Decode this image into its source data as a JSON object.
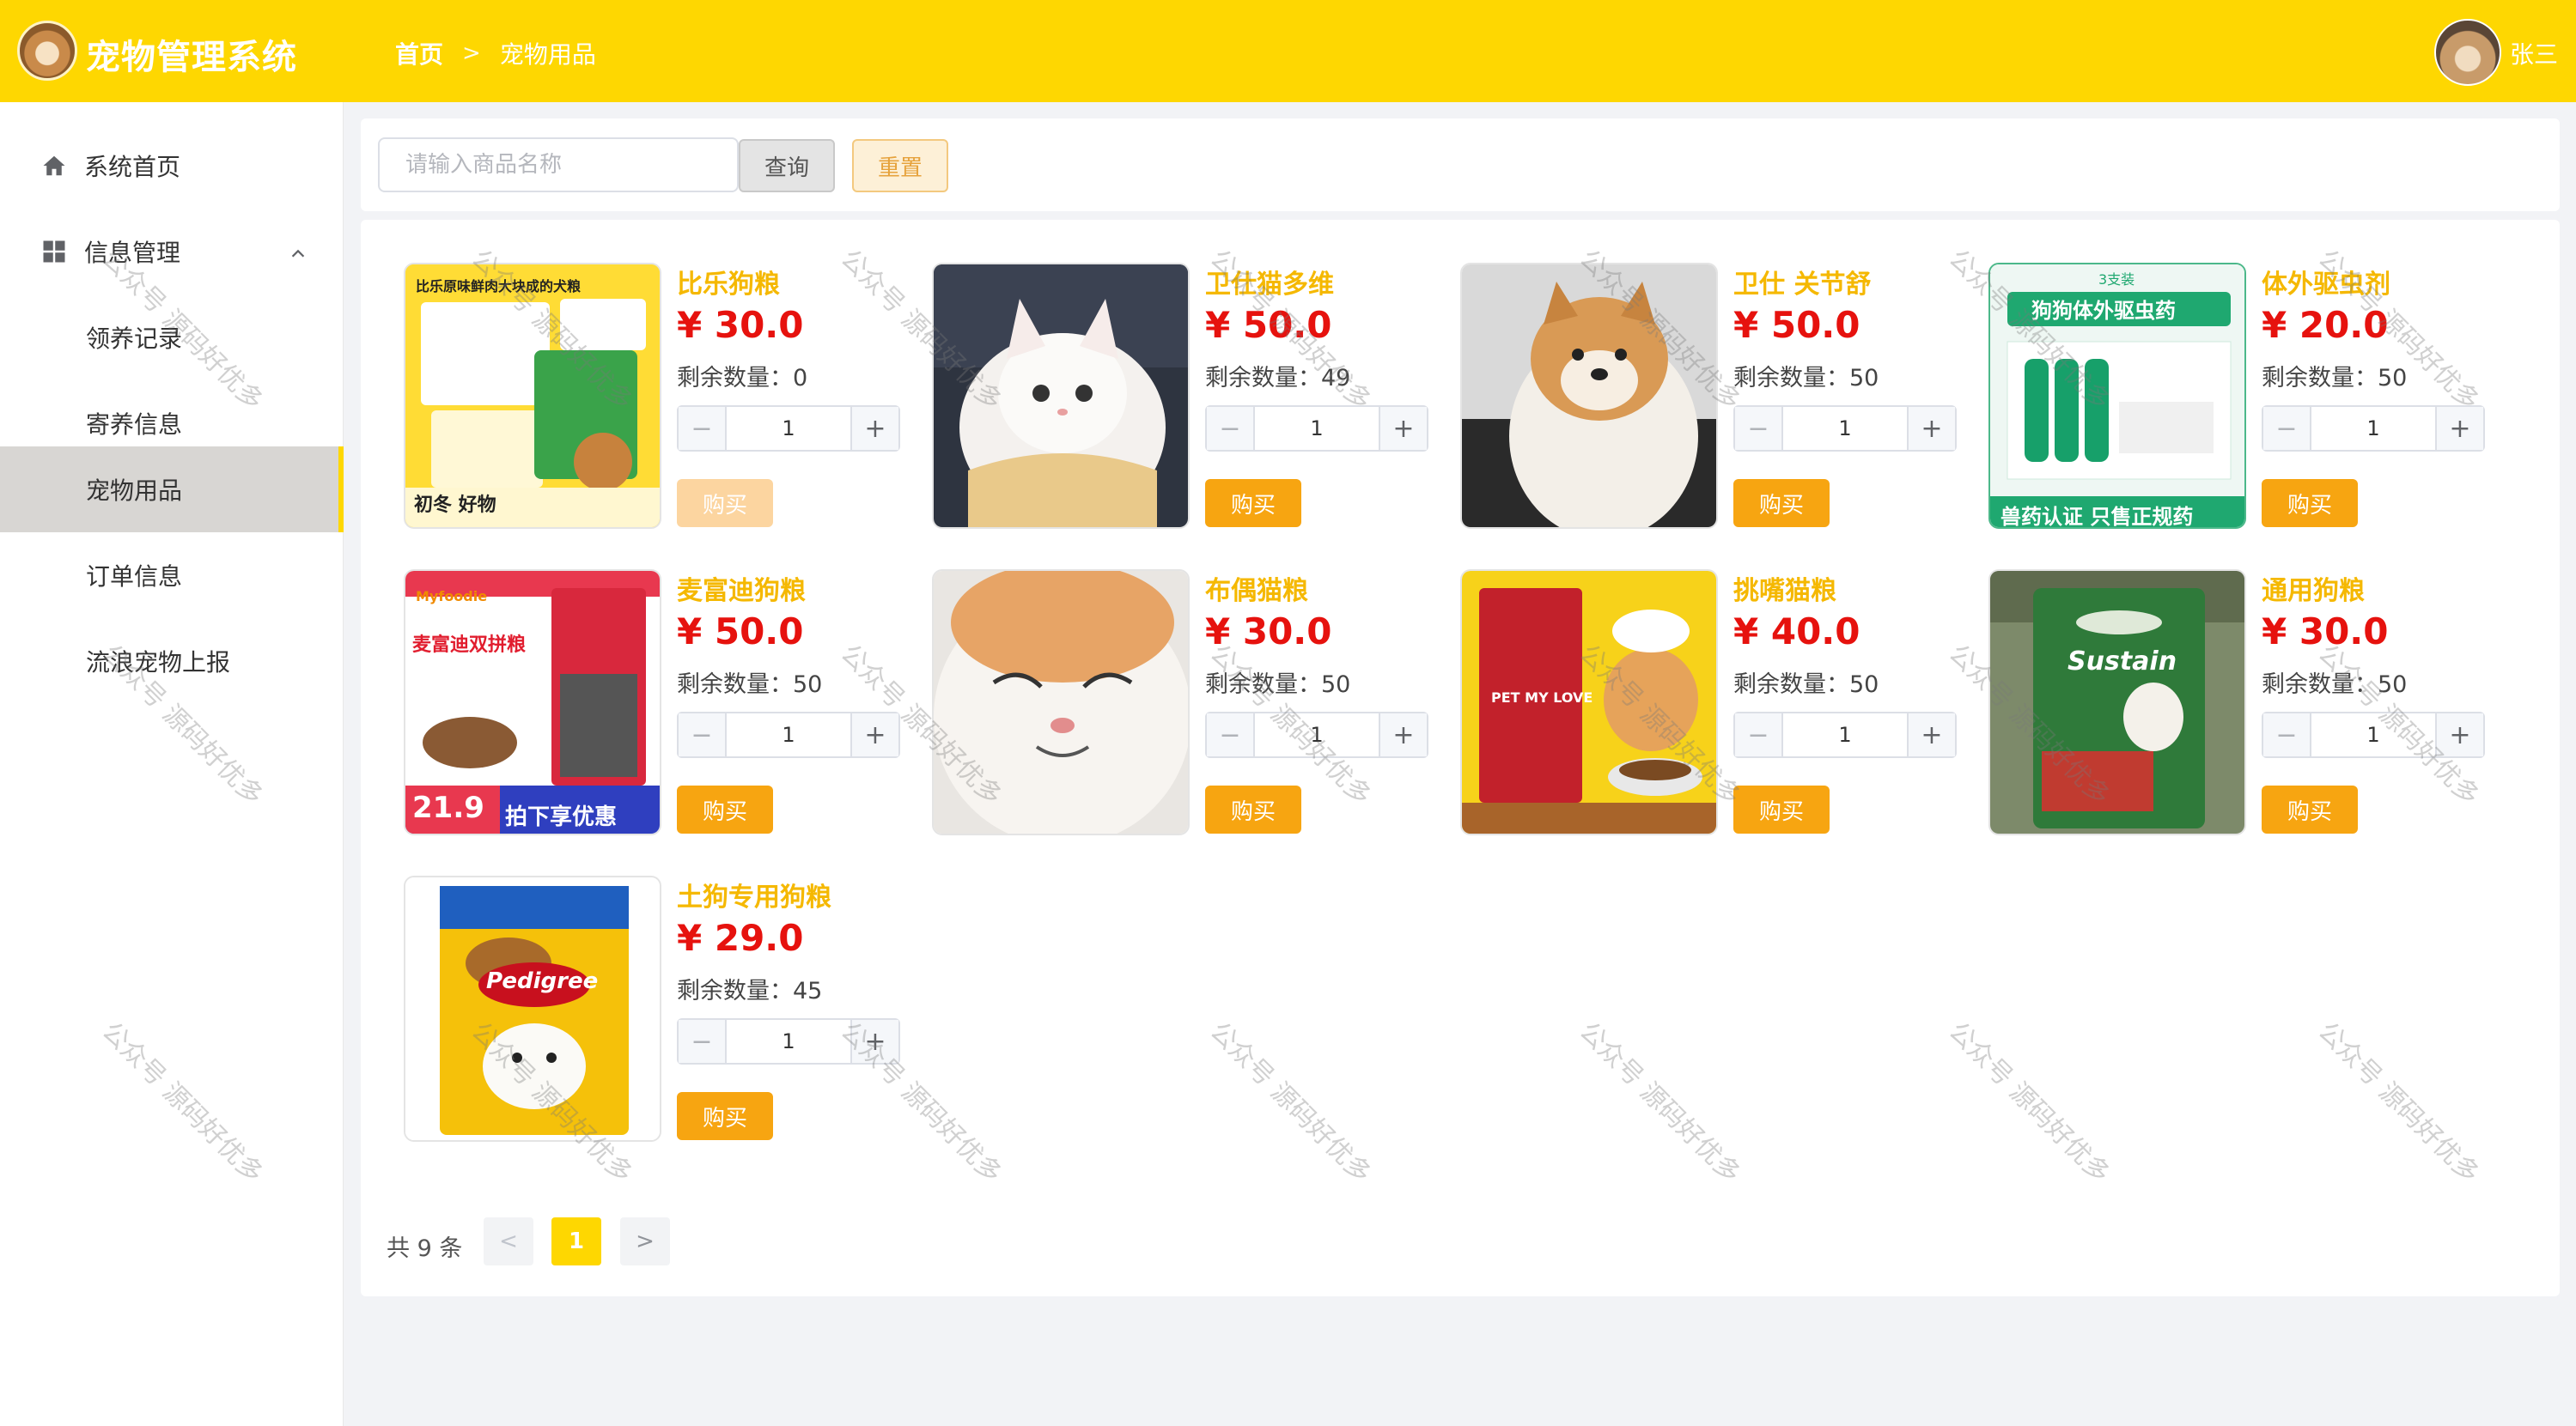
{
  "header": {
    "app_title": "宠物管理系统",
    "breadcrumb_home": "首页",
    "breadcrumb_sep": ">",
    "breadcrumb_current": "宠物用品",
    "user_name": "张三"
  },
  "sidebar": {
    "items": [
      {
        "label": "系统首页",
        "icon": "home-icon"
      },
      {
        "label": "信息管理",
        "icon": "grid-icon"
      },
      {
        "label": "领养记录"
      },
      {
        "label": "寄养信息"
      },
      {
        "label": "宠物用品"
      },
      {
        "label": "订单信息"
      },
      {
        "label": "流浪宠物上报"
      }
    ],
    "active": "宠物用品"
  },
  "search": {
    "placeholder": "请输入商品名称",
    "query_label": "查询",
    "reset_label": "重置"
  },
  "products": [
    {
      "name": "比乐狗粮",
      "price": "¥ 30.0",
      "stock": "剩余数量：0",
      "qty": "1",
      "buy": "购买",
      "disabled": true
    },
    {
      "name": "卫仕猫多维",
      "price": "¥ 50.0",
      "stock": "剩余数量：49",
      "qty": "1",
      "buy": "购买"
    },
    {
      "name": "卫仕 关节舒",
      "price": "¥ 50.0",
      "stock": "剩余数量：50",
      "qty": "1",
      "buy": "购买"
    },
    {
      "name": "体外驱虫剂",
      "price": "¥ 20.0",
      "stock": "剩余数量：50",
      "qty": "1",
      "buy": "购买"
    },
    {
      "name": "麦富迪狗粮",
      "price": "¥ 50.0",
      "stock": "剩余数量：50",
      "qty": "1",
      "buy": "购买"
    },
    {
      "name": "布偶猫粮",
      "price": "¥ 30.0",
      "stock": "剩余数量：50",
      "qty": "1",
      "buy": "购买"
    },
    {
      "name": "挑嘴猫粮",
      "price": "¥ 40.0",
      "stock": "剩余数量：50",
      "qty": "1",
      "buy": "购买"
    },
    {
      "name": "通用狗粮",
      "price": "¥ 30.0",
      "stock": "剩余数量：50",
      "qty": "1",
      "buy": "购买"
    },
    {
      "name": "土狗专用狗粮",
      "price": "¥ 29.0",
      "stock": "剩余数量：45",
      "qty": "1",
      "buy": "购买"
    }
  ],
  "image_texts": {
    "p1_top": "比乐原味鲜肉大块成的犬粮",
    "p1_bottom": "初冬 好物",
    "p4_badge": "3支装",
    "p4_title": "狗狗体外驱虫药",
    "p4_bottom": "兽药认证 只售正规药",
    "p5_brand": "Myfoodie",
    "p5_title": "麦富迪双拼粮",
    "p5_price": "21.9",
    "p5_cta": "拍下享优惠",
    "p7_text": "PET MY LOVE",
    "p8_text": "Sustain",
    "p9_text": "Pedigree"
  },
  "pagination": {
    "total": "共 9 条",
    "current": "1",
    "prev": "<",
    "next": ">"
  },
  "watermark": "公众号 源码好优多",
  "colors": {
    "header": "#fed701",
    "accent": "#f7a511",
    "price": "#e6120e",
    "name": "#f5b800"
  }
}
